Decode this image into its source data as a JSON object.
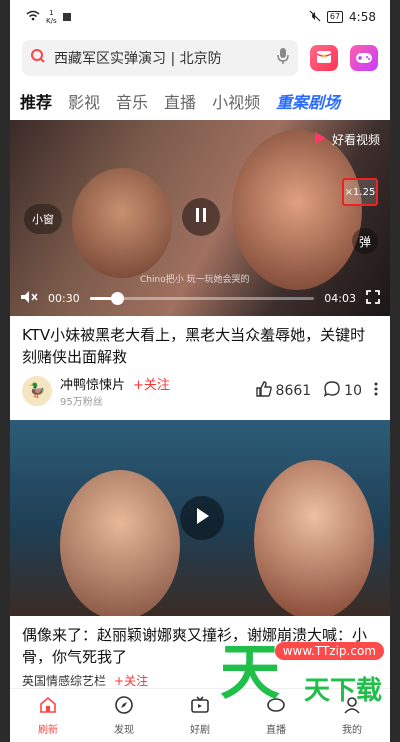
{
  "status": {
    "speed_top": "1",
    "speed_unit": "K/s",
    "battery": "67",
    "time": "4:58"
  },
  "search": {
    "text": "西藏军区实弹演习 | 北京防"
  },
  "tabs": [
    "推荐",
    "影视",
    "音乐",
    "直播",
    "小视频",
    "重案剧场"
  ],
  "video1": {
    "brand": "好看视频",
    "pip_label": "小窗",
    "speed_label": "×1.25",
    "danmu_label": "弹",
    "subtitle": "Chino把小 玩一玩她会哭的",
    "current_time": "00:30",
    "duration": "04:03",
    "progress": 0.12
  },
  "post1": {
    "title": "KTV小妹被黑老大看上，黑老大当众羞辱她，关键时刻赌侠出面解救",
    "author": "冲鸭惊悚片",
    "follow": "+关注",
    "fans": "95万粉丝",
    "likes": "8661",
    "comments": "10"
  },
  "post2": {
    "title": "偶像来了：赵丽颖谢娜爽又撞衫，谢娜崩溃大喊：小骨，你气死我了",
    "author_partial": "英国情感综艺栏",
    "follow_partial": "+关注"
  },
  "nav": [
    {
      "label": "刷新"
    },
    {
      "label": "发现"
    },
    {
      "label": "好剧"
    },
    {
      "label": "直播"
    },
    {
      "label": "我的"
    }
  ],
  "watermark": {
    "big": "天",
    "url": "www.TTzip.com",
    "sub": "天下载"
  }
}
